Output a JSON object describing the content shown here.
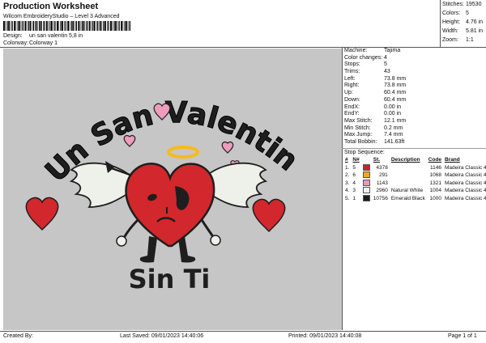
{
  "header": {
    "title": "Production Worksheet",
    "software": "Wilcom EmbroideryStudio – Level 3 Advanced",
    "design_label": "Design:",
    "design_value": "un san valentin 5,8 in",
    "colorway_label": "Colorway:",
    "colorway_value": "Colorway 1"
  },
  "summary": [
    {
      "label": "Stitches:",
      "value": "19530"
    },
    {
      "label": "Colors:",
      "value": "5"
    },
    {
      "label": "Height:",
      "value": "4.76 in"
    },
    {
      "label": "Width:",
      "value": "5.81 in"
    },
    {
      "label": "Zoom:",
      "value": "1:1"
    }
  ],
  "details": [
    {
      "label": "Machine:",
      "value": "Tajima"
    },
    {
      "label": "Color changes:",
      "value": "4"
    },
    {
      "label": "Stops:",
      "value": "5"
    },
    {
      "label": "Trims:",
      "value": "43"
    },
    {
      "label": "Left:",
      "value": "73.8 mm"
    },
    {
      "label": "Right:",
      "value": "73.8 mm"
    },
    {
      "label": "Up:",
      "value": "60.4 mm"
    },
    {
      "label": "Down:",
      "value": "60.4 mm"
    },
    {
      "label": "EndX:",
      "value": "0.00 in"
    },
    {
      "label": "EndY:",
      "value": "0.00 in"
    },
    {
      "label": "Max Stitch:",
      "value": "12.1 mm"
    },
    {
      "label": "Min Stitch:",
      "value": "0.2 mm"
    },
    {
      "label": "Max Jump:",
      "value": "7.4 mm"
    },
    {
      "label": "Total Bobbin:",
      "value": "141.63ft"
    }
  ],
  "stop_sequence": {
    "title": "Stop Sequence:",
    "headers": [
      "#",
      "N#",
      "St.",
      "Description",
      "Code",
      "Brand"
    ],
    "rows": [
      {
        "num": "1.",
        "n": "5",
        "color": "#c8242c",
        "st": "4378",
        "desc": "",
        "code": "1146",
        "brand": "Madeira Classic 40"
      },
      {
        "num": "2.",
        "n": "6",
        "color": "#f2a81c",
        "st": "291",
        "desc": "",
        "code": "1068",
        "brand": "Madeira Classic 40"
      },
      {
        "num": "3.",
        "n": "4",
        "color": "#e79ab6",
        "st": "1143",
        "desc": "",
        "code": "1321",
        "brand": "Madeira Classic 40"
      },
      {
        "num": "4.",
        "n": "3",
        "color": "#f4f4ee",
        "st": "2960",
        "desc": "Natural White",
        "code": "1004",
        "brand": "Madeira Classic 40"
      },
      {
        "num": "5.",
        "n": "1",
        "color": "#1a1a1a",
        "st": "10756",
        "desc": "Emerald Black",
        "code": "1000",
        "brand": "Madeira Classic 40"
      }
    ]
  },
  "design": {
    "text_top": "Un San Valentin",
    "text_bottom": "Sin Ti",
    "colors": {
      "red": "#d2272c",
      "black": "#1e1e1e",
      "pink": "#ee9cbb",
      "white": "#eef0ea",
      "gold": "#f4bb1f"
    }
  },
  "footer": {
    "created_by": "Created By:",
    "last_saved": "Last Saved: 09/01/2023 14:40:06",
    "printed": "Printed: 09/01/2023 14:40:08",
    "page": "Page 1 of 1"
  }
}
